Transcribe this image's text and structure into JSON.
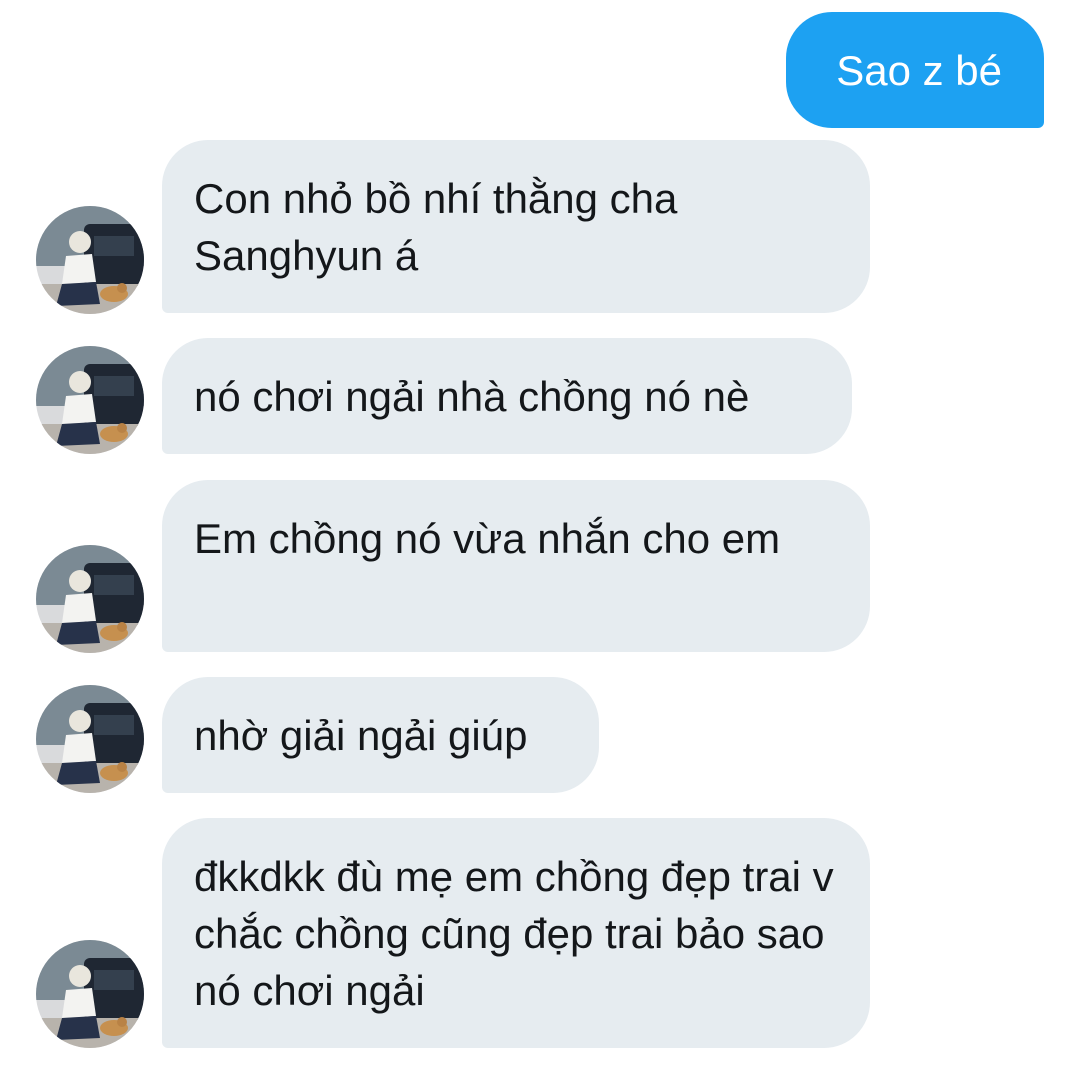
{
  "conversation": {
    "messages": [
      {
        "direction": "outgoing",
        "text": "Sao z bé"
      },
      {
        "direction": "incoming",
        "text": "Con nhỏ bồ nhí thằng cha Sanghyun á"
      },
      {
        "direction": "incoming",
        "text": "nó chơi ngải nhà chồng nó nè"
      },
      {
        "direction": "incoming",
        "text": "Em chồng nó vừa nhắn cho em"
      },
      {
        "direction": "incoming",
        "text": "nhờ giải ngải giúp"
      },
      {
        "direction": "incoming",
        "text": "đkkdkk đù mẹ em chồng đẹp trai v chắc chồng cũng đẹp trai bảo sao nó chơi ngải"
      }
    ]
  },
  "colors": {
    "outgoing_bubble": "#1da1f2",
    "incoming_bubble": "#e6ecf0",
    "incoming_text": "#14171a",
    "outgoing_text": "#ffffff",
    "background": "#ffffff"
  },
  "icons": {
    "avatar": "user-photo-avatar"
  }
}
